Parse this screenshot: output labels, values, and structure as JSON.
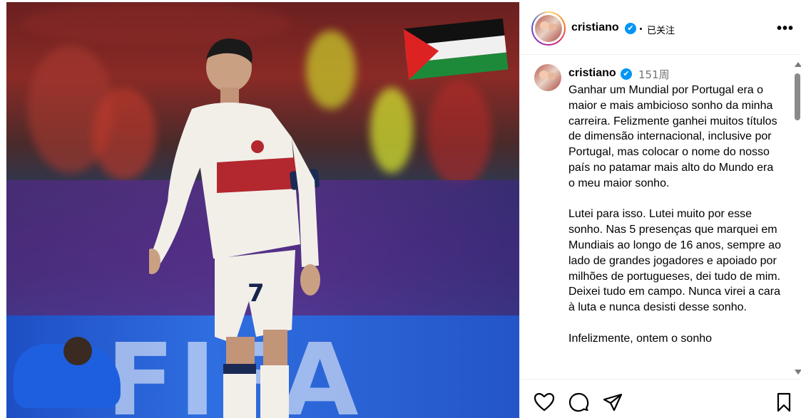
{
  "post": {
    "image_alt": "cristiano-photo",
    "username": "cristiano",
    "verified_mark": "✔",
    "follow_status": "已关注",
    "more_label": "•••"
  },
  "caption": {
    "username": "cristiano",
    "time": "151周",
    "text": "Ganhar um Mundial por Portugal era o maior e mais ambicioso sonho da minha carreira. Felizmente ganhei muitos títulos de dimensão internacional, inclusive por Portugal, mas colocar o nome do nosso país no patamar mais alto do Mundo era o meu maior sonho.\n\nLutei para isso. Lutei muito por esse sonho. Nas 5 presenças que marquei em Mundiais ao longo de 16 anos, sempre ao lado de grandes jogadores e apoiado por milhões de portugueses, dei tudo de mim. Deixei tudo em campo. Nunca virei a cara à luta e nunca desisti desse sonho.\n\nInfelizmente, ontem o sonho"
  },
  "photo": {
    "banner_text": "FIFA",
    "shirt_number": "7"
  },
  "icons": {
    "like": "heart-icon",
    "comment": "comment-icon",
    "share": "send-icon",
    "save": "bookmark-icon"
  },
  "colors": {
    "verified": "#0095f6",
    "muted": "#737373",
    "border": "#efefef"
  }
}
